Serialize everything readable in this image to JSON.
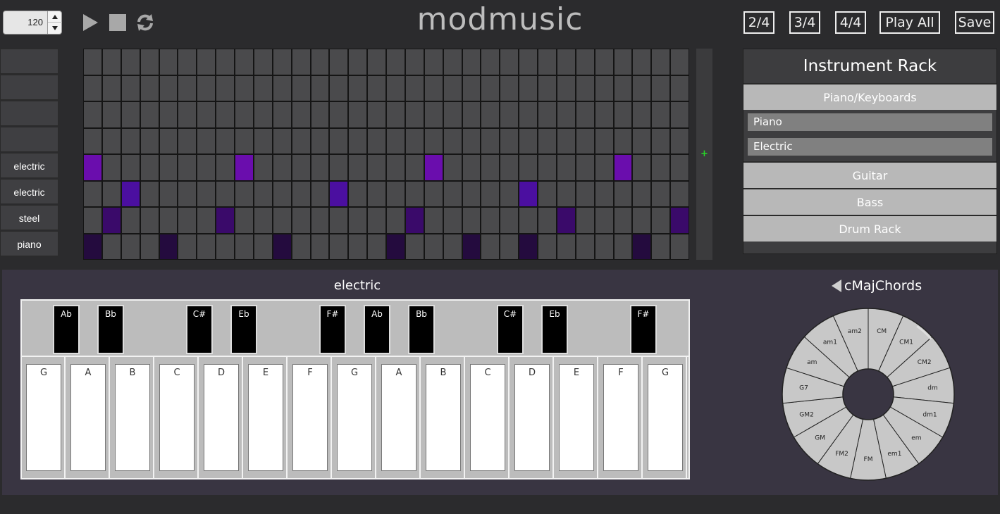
{
  "header": {
    "bpm": "120",
    "title": "modmusic",
    "buttons": [
      "2/4",
      "3/4",
      "4/4",
      "Play All",
      "Save"
    ]
  },
  "tracks": [
    {
      "label": "",
      "active": []
    },
    {
      "label": "",
      "active": []
    },
    {
      "label": "",
      "active": []
    },
    {
      "label": "",
      "active": []
    },
    {
      "label": "electric",
      "active": [
        0,
        8,
        18,
        28
      ],
      "color": "#6a0dad"
    },
    {
      "label": "electric",
      "active": [
        2,
        13,
        23
      ],
      "color": "#4b0fa0"
    },
    {
      "label": "steel",
      "active": [
        1,
        7,
        17,
        25,
        31
      ],
      "color": "#3a0a6a"
    },
    {
      "label": "piano",
      "active": [
        0,
        4,
        10,
        16,
        20,
        23,
        29
      ],
      "color": "#240b3e"
    }
  ],
  "grid": {
    "columns": 32,
    "rows": 8,
    "add_label": "+"
  },
  "rack": {
    "title": "Instrument Rack",
    "categories": [
      {
        "label": "Piano/Keyboards",
        "items": [
          "Piano",
          "Electric"
        ]
      },
      {
        "label": "Guitar"
      },
      {
        "label": "Bass"
      },
      {
        "label": "Drum Rack"
      }
    ]
  },
  "keyboard": {
    "title": "electric",
    "white_keys": [
      "G",
      "A",
      "B",
      "C",
      "D",
      "E",
      "F",
      "G",
      "A",
      "B",
      "C",
      "D",
      "E",
      "F",
      "G"
    ],
    "black_keys": [
      {
        "label": "Ab",
        "after": 0
      },
      {
        "label": "Bb",
        "after": 1
      },
      {
        "label": "C#",
        "after": 3
      },
      {
        "label": "Eb",
        "after": 4
      },
      {
        "label": "F#",
        "after": 6
      },
      {
        "label": "Ab",
        "after": 7
      },
      {
        "label": "Bb",
        "after": 8
      },
      {
        "label": "C#",
        "after": 10
      },
      {
        "label": "Eb",
        "after": 11
      },
      {
        "label": "F#",
        "after": 13
      }
    ]
  },
  "chords": {
    "title": "cMajChords",
    "segments": [
      "CM",
      "CM1",
      "CM2",
      "dm",
      "dm1",
      "em",
      "em1",
      "FM",
      "FM2",
      "GM",
      "GM2",
      "G7",
      "am",
      "am1",
      "am2"
    ],
    "colors": {
      "segment": "#c8c8c8",
      "line": "#222222",
      "center": "#393542",
      "progress": "#dddddd"
    }
  }
}
